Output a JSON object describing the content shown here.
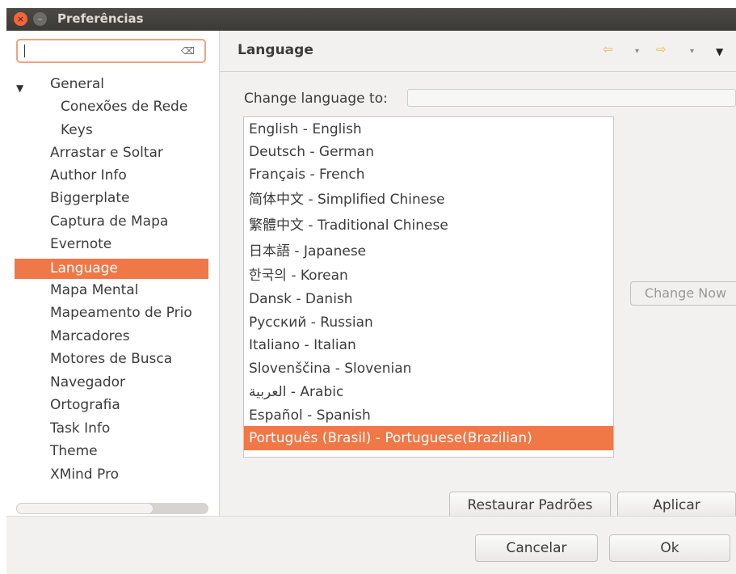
{
  "window": {
    "title": "Preferências"
  },
  "search": {
    "value": "",
    "clear_icon": "⌫"
  },
  "tree": [
    {
      "label": "General"
    },
    {
      "label": "Conexões de Rede"
    },
    {
      "label": "Keys"
    },
    {
      "label": "Arrastar e Soltar"
    },
    {
      "label": "Author Info"
    },
    {
      "label": "Biggerplate"
    },
    {
      "label": "Captura de Mapa"
    },
    {
      "label": "Evernote"
    },
    {
      "label": "Language"
    },
    {
      "label": "Mapa Mental"
    },
    {
      "label": "Mapeamento de Prio"
    },
    {
      "label": "Marcadores"
    },
    {
      "label": "Motores de Busca"
    },
    {
      "label": "Navegador"
    },
    {
      "label": "Ortografia"
    },
    {
      "label": "Task Info"
    },
    {
      "label": "Theme"
    },
    {
      "label": "XMind Pro"
    }
  ],
  "page": {
    "title": "Language",
    "change_language_label": "Change language to:",
    "change_now": "Change Now",
    "languages": [
      "English - English",
      "Deutsch - German",
      "Français - French",
      "简体中文 - Simplified Chinese",
      "繁體中文 - Traditional Chinese",
      "日本語 - Japanese",
      "한국의 - Korean",
      "Dansk - Danish",
      "Русский - Russian",
      "Italiano - Italian",
      "Slovenščina - Slovenian",
      "العربية - Arabic",
      "Español - Spanish",
      "Português (Brasil) - Portuguese(Brazilian)"
    ],
    "selected_language_index": 13,
    "restore_defaults": "Restaurar Padrões",
    "apply": "Aplicar"
  },
  "dialog": {
    "cancel": "Cancelar",
    "ok": "Ok"
  },
  "colors": {
    "accent": "#f07746",
    "title_bar": "#3c3b37"
  },
  "icons": {
    "nav_back": "⇦",
    "nav_forward": "⇨",
    "dropdown": "▾",
    "view_menu": "▼",
    "tree_expanded": "▼",
    "close": "×",
    "minimize": "–"
  }
}
